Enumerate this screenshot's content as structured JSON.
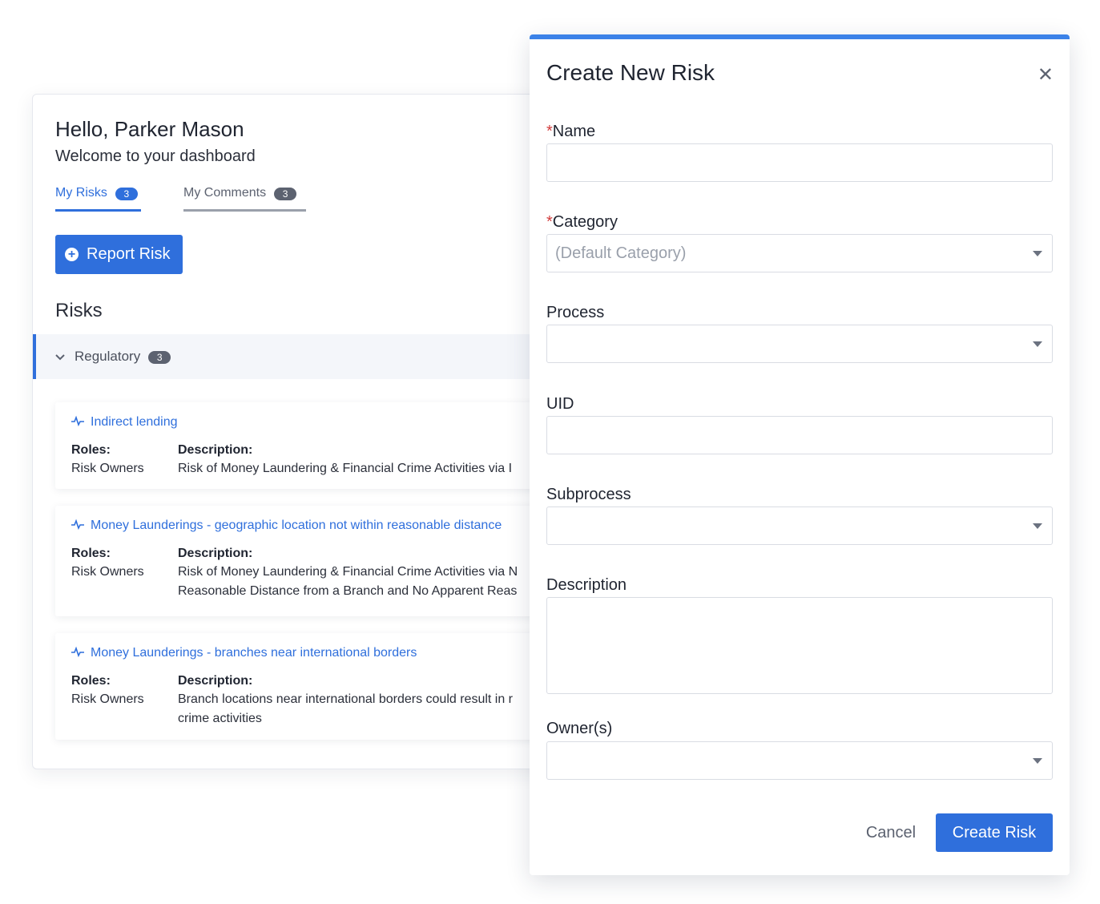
{
  "dashboard": {
    "greeting": "Hello, Parker Mason",
    "welcome": "Welcome to your dashboard",
    "tabs": [
      {
        "label": "My Risks",
        "count": "3"
      },
      {
        "label": "My Comments",
        "count": "3"
      }
    ],
    "report_button": "Report Risk",
    "risks_heading": "Risks",
    "group": {
      "label": "Regulatory",
      "count": "3"
    },
    "roles_label": "Roles:",
    "description_label": "Description:",
    "risks": [
      {
        "title": "Indirect lending",
        "roles": "Risk Owners",
        "description_lines": [
          "Risk of Money Laundering & Financial Crime Activities via I"
        ]
      },
      {
        "title": "Money Launderings - geographic location not within reasonable distance",
        "roles": "Risk Owners",
        "description_lines": [
          "Risk of Money Laundering & Financial Crime Activities via N",
          "Reasonable Distance from a Branch and No Apparent Reas"
        ]
      },
      {
        "title": "Money Launderings - branches near international borders",
        "roles": "Risk Owners",
        "description_lines": [
          "Branch locations near international borders could result in r",
          "crime activities"
        ]
      }
    ]
  },
  "modal": {
    "title": "Create New Risk",
    "close_symbol": "✕",
    "fields": {
      "name": {
        "label": "Name",
        "required": "*",
        "value": ""
      },
      "category": {
        "label": "Category",
        "required": "*",
        "placeholder": "(Default Category)"
      },
      "process": {
        "label": "Process",
        "value": ""
      },
      "uid": {
        "label": "UID",
        "value": ""
      },
      "subprocess": {
        "label": "Subprocess",
        "value": ""
      },
      "description": {
        "label": "Description",
        "value": ""
      },
      "owners": {
        "label": "Owner(s)",
        "value": ""
      }
    },
    "cancel_label": "Cancel",
    "submit_label": "Create Risk"
  },
  "colors": {
    "accent": "#2f6fdc",
    "modal_top_border": "#3b82e8",
    "required": "#d23c3c"
  }
}
